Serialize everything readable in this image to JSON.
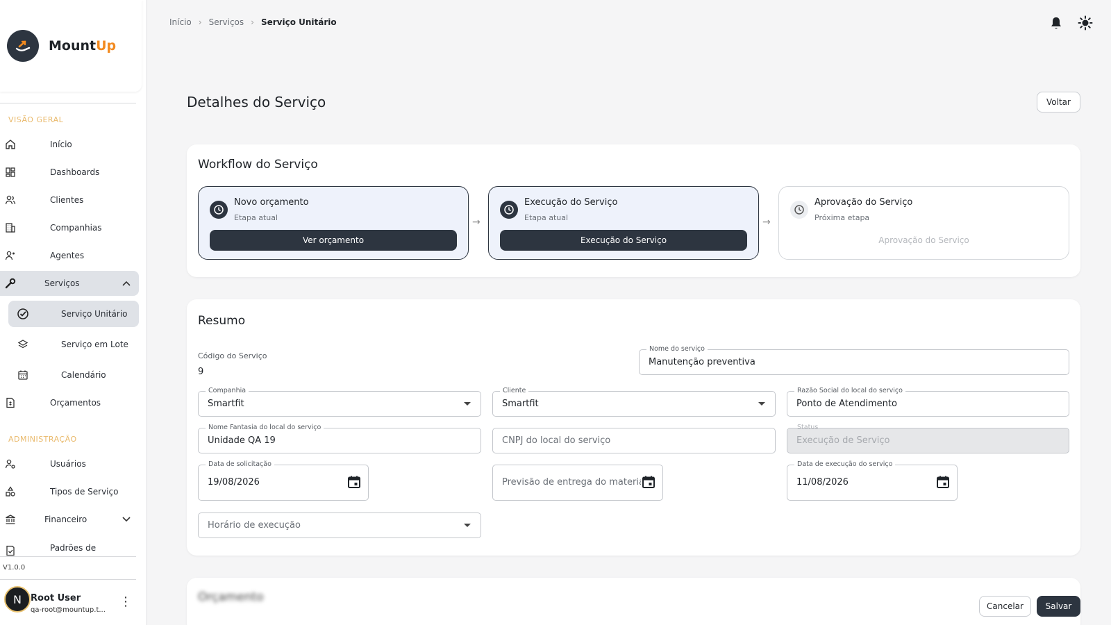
{
  "app": {
    "brand_main": "Mount",
    "brand_accent": "Up",
    "version": "V1.0.0",
    "accent_color": "#f28a1f",
    "dark_color": "#2d3540"
  },
  "sidebar": {
    "section_overview": "VISÃO GERAL",
    "section_admin": "ADMINISTRAÇÃO",
    "items": {
      "inicio": "Início",
      "dashboards": "Dashboards",
      "clientes": "Clientes",
      "companhias": "Companhias",
      "agentes": "Agentes",
      "servicos": "Serviços",
      "servico_unitario": "Serviço Unitário",
      "servico_lote": "Serviço em Lote",
      "calendario": "Calendário",
      "orcamentos": "Orçamentos",
      "usuarios": "Usuários",
      "tipos_servico": "Tipos de Serviço",
      "financeiro": "Financeiro",
      "padroes": "Padrões de"
    }
  },
  "user": {
    "initial": "N",
    "name": "Root User",
    "email": "qa-root@mountup.t..."
  },
  "breadcrumb": {
    "home": "Início",
    "services": "Serviços",
    "current": "Serviço Unitário"
  },
  "page": {
    "title": "Detalhes do Serviço",
    "back_button": "Voltar"
  },
  "workflow": {
    "title": "Workflow do Serviço",
    "steps": [
      {
        "title": "Novo orçamento",
        "subtitle": "Etapa atual",
        "button": "Ver orçamento",
        "state": "current"
      },
      {
        "title": "Execução do Serviço",
        "subtitle": "Etapa atual",
        "button": "Execução do Serviço",
        "state": "current"
      },
      {
        "title": "Aprovação do Serviço",
        "subtitle": "Próxima etapa",
        "button": "Aprovação do Serviço",
        "state": "next"
      }
    ]
  },
  "summary": {
    "title": "Resumo",
    "code_label": "Código do Serviço",
    "code_value": "9",
    "fields": {
      "service_name": {
        "label": "Nome do serviço",
        "value": "Manutenção preventiva"
      },
      "company": {
        "label": "Companhia",
        "value": "Smartfit"
      },
      "client": {
        "label": "Cliente",
        "value": "Smartfit"
      },
      "legal_name": {
        "label": "Razão Social do local do serviço",
        "value": "Ponto de Atendimento"
      },
      "trade_name": {
        "label": "Nome Fantasia do local do serviço",
        "value": "Unidade QA 19"
      },
      "cnpj": {
        "placeholder": "CNPJ do local do serviço"
      },
      "status": {
        "label": "Status",
        "value": "Execução de Serviço"
      },
      "request_date": {
        "label": "Data de solicitação",
        "value": "19/08/2026"
      },
      "material_forecast": {
        "placeholder": "Previsão de entrega do material"
      },
      "execution_date": {
        "label": "Data de execução do serviço",
        "value": "11/08/2026"
      },
      "execution_time": {
        "placeholder": "Horário de execução"
      }
    }
  },
  "footer": {
    "cancel": "Cancelar",
    "save": "Salvar",
    "next_section_title": "Orçamento"
  }
}
